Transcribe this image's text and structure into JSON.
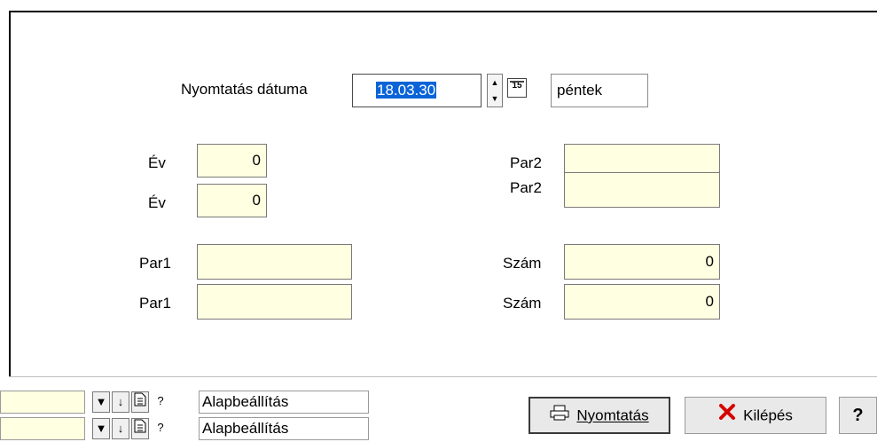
{
  "form": {
    "print_date_label": "Nyomtatás dátuma",
    "print_date_value": "18.03.30",
    "day_of_week": "péntek",
    "year_label_1": "Év",
    "year_value_1": "0",
    "year_label_2": "Év",
    "year_value_2": "0",
    "par1_label_1": "Par1",
    "par1_value_1": "",
    "par1_label_2": "Par1",
    "par1_value_2": "",
    "par2_label_1": "Par2",
    "par2_value_1": "",
    "par2_label_2": "Par2",
    "par2_value_2": "",
    "szam_label_1": "Szám",
    "szam_value_1": "0",
    "szam_label_2": "Szám",
    "szam_value_2": "0",
    "calendar_glyph": "15"
  },
  "toolbar": {
    "rows": [
      {
        "combo_value": "",
        "setting_text": "Alapbeállítás"
      },
      {
        "combo_value": "",
        "setting_text": "Alapbeállítás"
      }
    ],
    "help_glyph": "?",
    "down_glyph": "↓"
  },
  "buttons": {
    "print_label": "Nyomtatás",
    "exit_label": "Kilépés",
    "help_label": "?"
  },
  "colors": {
    "field_bg": "#ffffe1",
    "selection": "#0a64d8",
    "exit_icon": "#d40000"
  }
}
